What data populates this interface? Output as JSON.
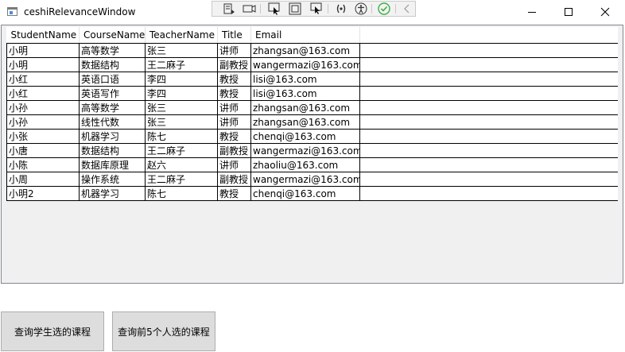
{
  "window": {
    "title": "ceshiRelevanceWindow",
    "icons": {
      "app": "window-app-icon",
      "minimize": "minimize-icon",
      "maximize": "maximize-icon",
      "close": "close-icon"
    }
  },
  "dev_toolbar": {
    "icons": [
      "live-visual-tree-icon",
      "display-layout-adorners-icon",
      "select-element-icon",
      "track-focus-icon",
      "preview-selection-icon",
      "binding-failures-icon",
      "accessibility-checker-icon",
      "checkmark-circle-icon",
      "collapse-chevron-icon"
    ],
    "accent_green": "#3cb043"
  },
  "grid": {
    "columns": [
      "StudentName",
      "CourseName",
      "TeacherName",
      "Title",
      "Email"
    ],
    "rows": [
      [
        "小明",
        "高等数学",
        "张三",
        "讲师",
        "zhangsan@163.com"
      ],
      [
        "小明",
        "数据结构",
        "王二麻子",
        "副教授",
        "wangermazi@163.com"
      ],
      [
        "小红",
        "英语口语",
        "李四",
        "教授",
        "lisi@163.com"
      ],
      [
        "小红",
        "英语写作",
        "李四",
        "教授",
        "lisi@163.com"
      ],
      [
        "小孙",
        "高等数学",
        "张三",
        "讲师",
        "zhangsan@163.com"
      ],
      [
        "小孙",
        "线性代数",
        "张三",
        "讲师",
        "zhangsan@163.com"
      ],
      [
        "小张",
        "机器学习",
        "陈七",
        "教授",
        "chenqi@163.com"
      ],
      [
        "小唐",
        "数据结构",
        "王二麻子",
        "副教授",
        "wangermazi@163.com"
      ],
      [
        "小陈",
        "数据库原理",
        "赵六",
        "讲师",
        "zhaoliu@163.com"
      ],
      [
        "小周",
        "操作系统",
        "王二麻子",
        "副教授",
        "wangermazi@163.com"
      ],
      [
        "小明2",
        "机器学习",
        "陈七",
        "教授",
        "chenqi@163.com"
      ]
    ]
  },
  "buttons": {
    "query_student_courses": "查询学生选的课程",
    "query_top5_courses": "查询前5个人选的课程"
  }
}
